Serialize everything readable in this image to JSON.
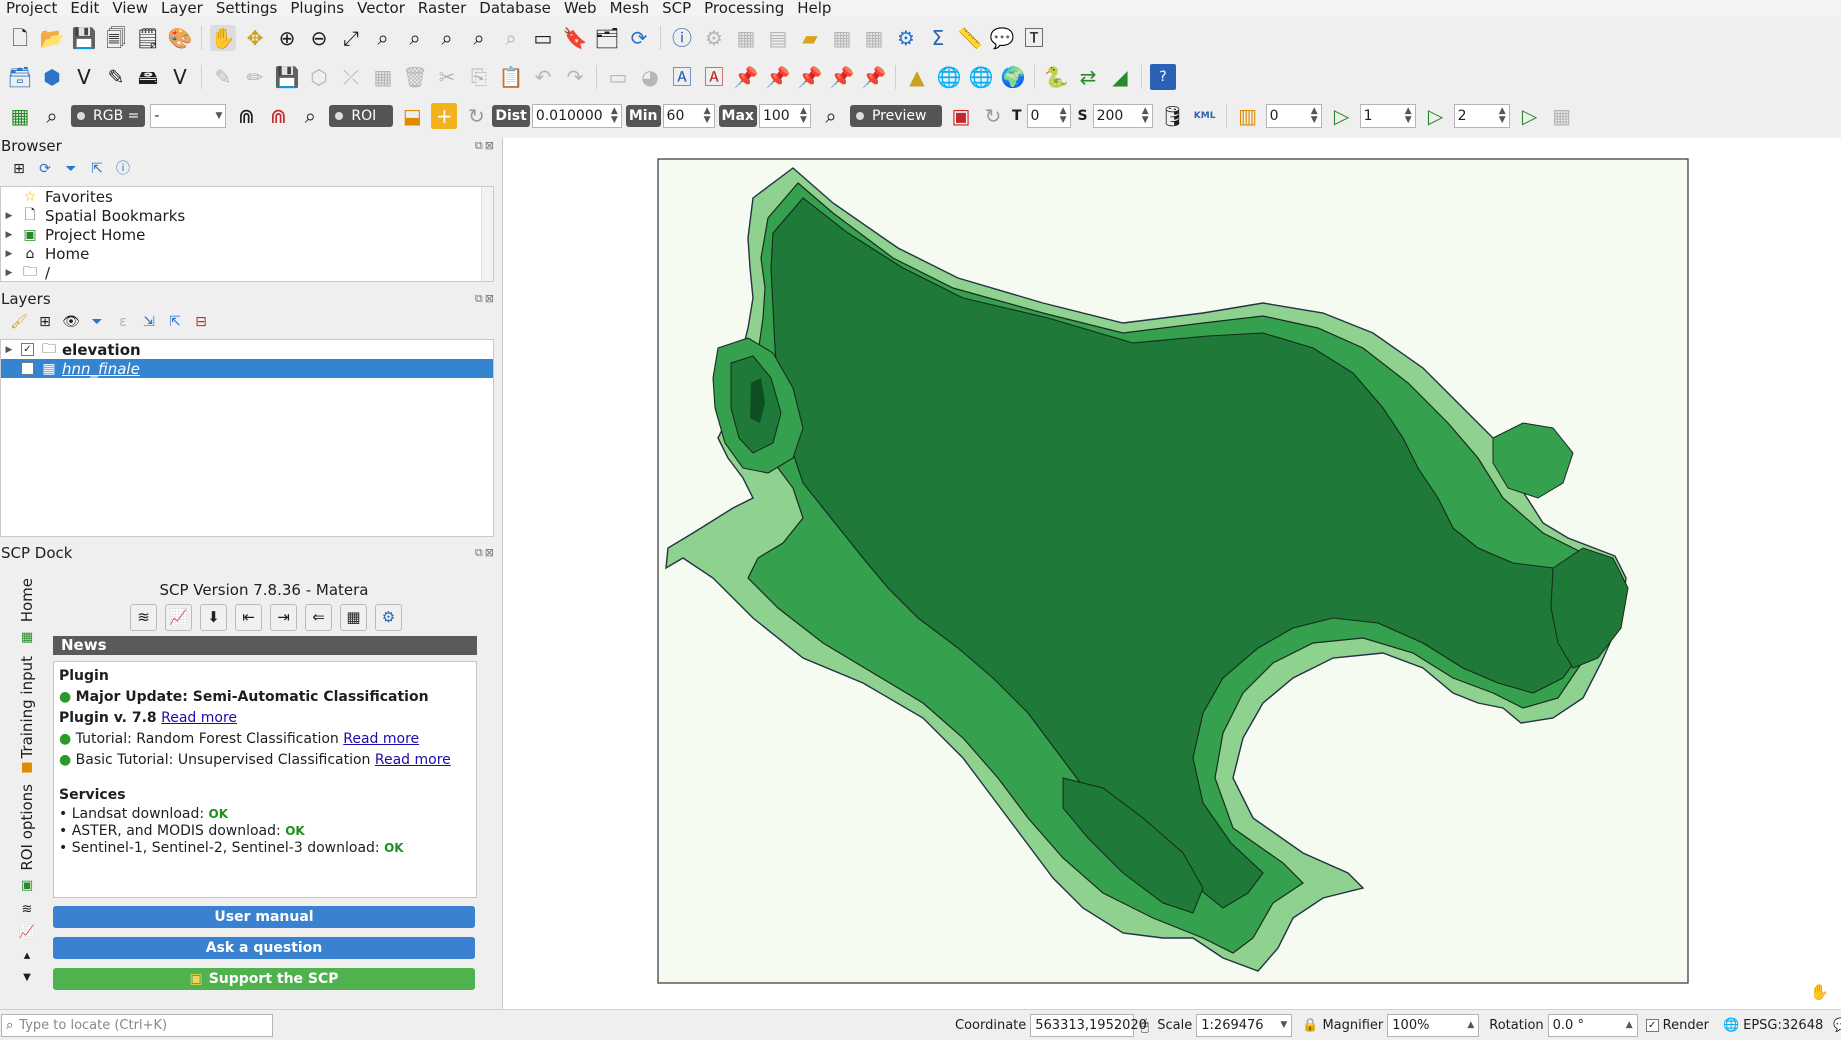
{
  "menu": [
    "Project",
    "Edit",
    "View",
    "Layer",
    "Settings",
    "Plugins",
    "Vector",
    "Raster",
    "Database",
    "Web",
    "Mesh",
    "SCP",
    "Processing",
    "Help"
  ],
  "scp_toolbar": {
    "rgb_label": "RGB =",
    "rgb_value": "-",
    "roi_label": "ROI",
    "dist_label": "Dist",
    "dist_value": "0.010000",
    "min_label": "Min",
    "min_value": "60",
    "max_label": "Max",
    "max_value": "100",
    "preview_label": "Preview",
    "t_label": "T",
    "t_value": "0",
    "s_label": "S",
    "s_value": "200",
    "kml_label": "KML",
    "band_a": "0",
    "band_b": "1",
    "band_c": "2"
  },
  "browser": {
    "title": "Browser",
    "items": [
      "Favorites",
      "Spatial Bookmarks",
      "Project Home",
      "Home",
      "/"
    ]
  },
  "layers": {
    "title": "Layers",
    "items": [
      {
        "name": "elevation",
        "checked": true
      },
      {
        "name": "hnn_finale",
        "checked": false
      }
    ]
  },
  "scp_dock": {
    "title": "SCP Dock",
    "tabs": [
      "Home",
      "Training input",
      "ROI options"
    ],
    "version": "SCP Version 7.8.36 - Matera",
    "news_header": "News",
    "plugin_header": "Plugin",
    "news": [
      {
        "text": "Major Update: Semi-Automatic Classification Plugin v. 7.8",
        "link": "Read more"
      },
      {
        "text": "Tutorial: Random Forest Classification",
        "link": "Read more"
      },
      {
        "text": "Basic Tutorial: Unsupervised Classification",
        "link": "Read more"
      }
    ],
    "services_header": "Services",
    "services": [
      {
        "text": "• Landsat download:",
        "status": "OK"
      },
      {
        "text": "• ASTER, and MODIS download:",
        "status": "OK"
      },
      {
        "text": "• Sentinel-1, Sentinel-2, Sentinel-3 download:",
        "status": "OK"
      }
    ],
    "user_manual": "User manual",
    "ask_question": "Ask a question",
    "support": "Support the SCP"
  },
  "colors": {
    "map_dark": "#1f7a3a",
    "map_mid": "#35a04e",
    "map_light": "#8fd18e",
    "map_bg": "#f6fbf2",
    "blue_button": "#3a82cf",
    "green_button": "#4fb24f",
    "selection": "#3584d0"
  },
  "status": {
    "locator_placeholder": "Type to locate (Ctrl+K)",
    "coordinate_label": "Coordinate",
    "coordinate_value": "563313,1952020",
    "scale_label": "Scale",
    "scale_value": "1:269476",
    "magnifier_label": "Magnifier",
    "magnifier_value": "100%",
    "rotation_label": "Rotation",
    "rotation_value": "0.0 °",
    "render_label": "Render",
    "crs": "EPSG:32648"
  }
}
